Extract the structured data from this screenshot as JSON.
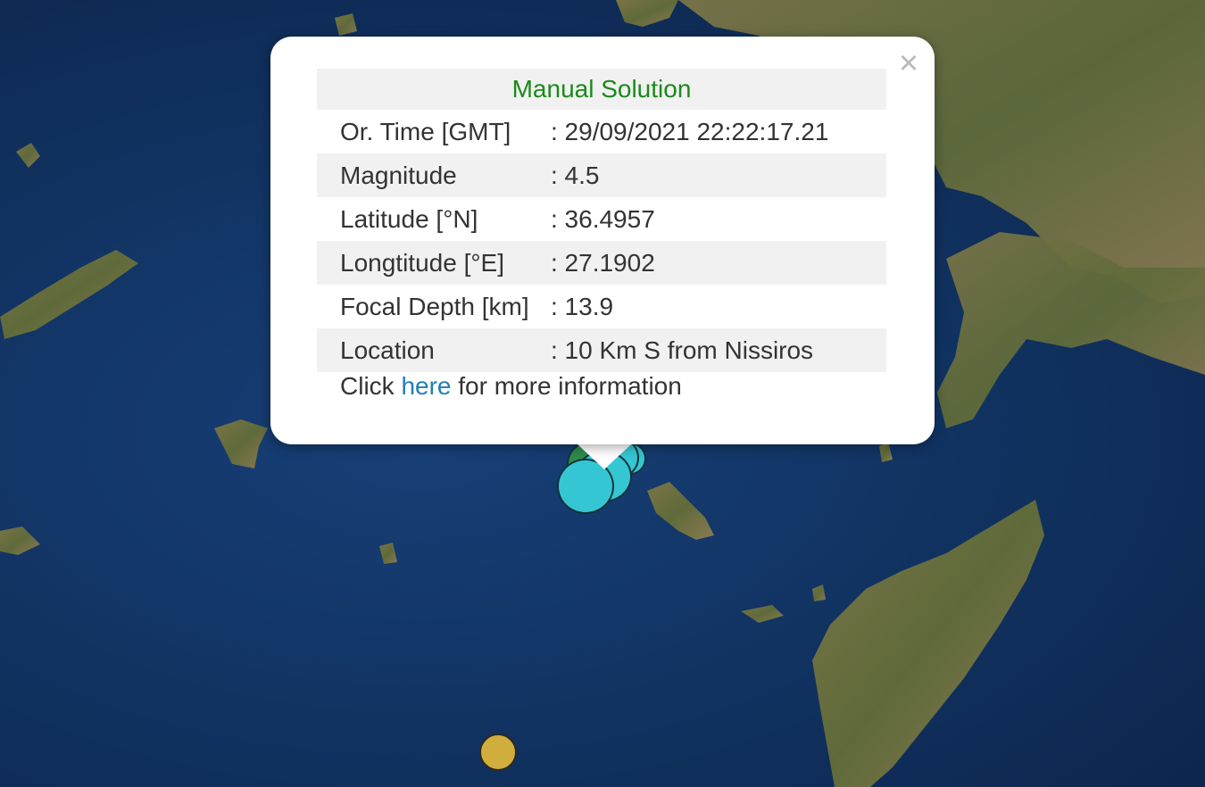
{
  "popup": {
    "title": "Manual Solution",
    "close_icon": "×",
    "rows": [
      {
        "label": "Or. Time [GMT]",
        "value": ": 29/09/2021 22:22:17.21"
      },
      {
        "label": "Magnitude",
        "value": ": 4.5"
      },
      {
        "label": "Latitude [°N]",
        "value": ": 36.4957"
      },
      {
        "label": "Longtitude [°E]",
        "value": ": 27.1902"
      },
      {
        "label": "Focal Depth [km]",
        "value": ": 13.9"
      },
      {
        "label": "Location",
        "value": ": 10 Km S from Nissiros"
      }
    ],
    "more_prefix": "Click",
    "more_link": "here",
    "more_suffix": "for more information"
  },
  "colors": {
    "title_green": "#1a8a1a",
    "link_blue": "#1f7fb5",
    "marker_cyan": "#35c6d4",
    "marker_green": "#2e8a4a",
    "marker_gold": "#d1ad3e",
    "sea": "#123565"
  }
}
